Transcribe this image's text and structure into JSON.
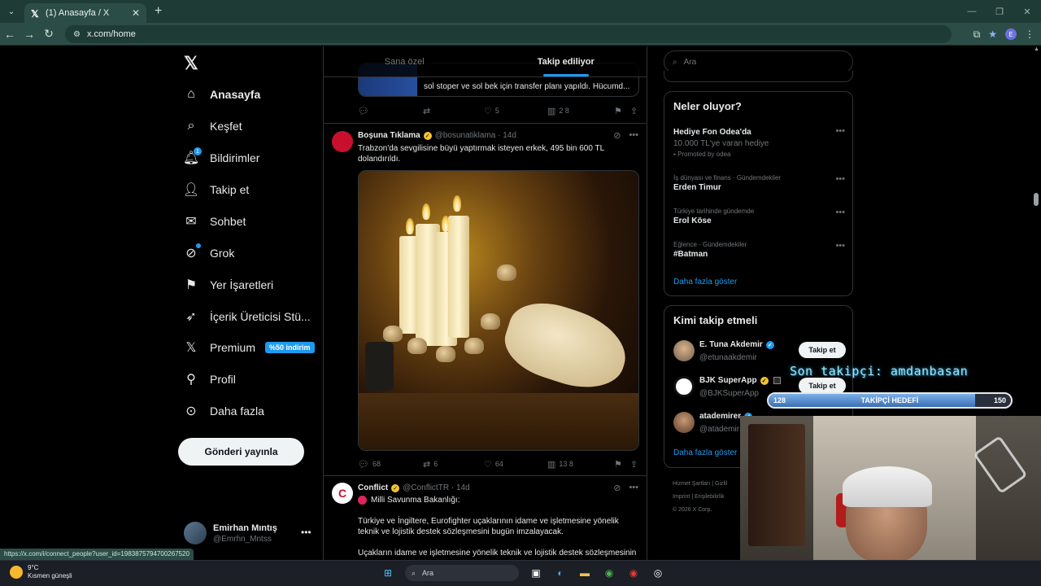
{
  "browser": {
    "tab_title": "(1) Anasayfa / X",
    "url": "x.com/home",
    "profile_initial": "E",
    "status_url": "https://x.com/i/connect_people?user_id=1983875794700267520"
  },
  "nav": {
    "items": [
      {
        "label": "Anasayfa",
        "icon": "home-icon"
      },
      {
        "label": "Keşfet",
        "icon": "search-icon"
      },
      {
        "label": "Bildirimler",
        "icon": "bell-icon",
        "badge": "1"
      },
      {
        "label": "Takip et",
        "icon": "add-user-icon"
      },
      {
        "label": "Sohbet",
        "icon": "mail-icon"
      },
      {
        "label": "Grok",
        "icon": "grok-icon"
      },
      {
        "label": "Yer İşaretleri",
        "icon": "bookmark-icon"
      },
      {
        "label": "İçerik Üreticisi Stü...",
        "icon": "rocket-icon"
      },
      {
        "label": "Premium",
        "icon": "x-icon",
        "promo": "%50 indirim"
      },
      {
        "label": "Profil",
        "icon": "person-icon"
      },
      {
        "label": "Daha fazla",
        "icon": "more-circle-icon"
      }
    ],
    "post_button": "Gönderi yayınla",
    "account": {
      "name": "Emirhan Mıntış",
      "handle": "@Emrhn_Mntss"
    }
  },
  "feed": {
    "tabs": [
      {
        "label": "Sana özel"
      },
      {
        "label": "Takip ediliyor"
      }
    ],
    "prev_card_text": "sol stoper ve sol bek için transfer planı yapıldı. Hücumd...",
    "prev_actions": {
      "reply": "",
      "repost": "",
      "like": "5",
      "views": "2 8"
    },
    "tweet1": {
      "name": "Boşuna Tıklama",
      "handle": "@bosunatiklama",
      "time": "14d",
      "text": "Trabzon'da sevgilisine büyü yaptırmak isteyen erkek, 495 bin 600 TL dolandırıldı.",
      "actions": {
        "reply": "68",
        "repost": "6",
        "like": "64",
        "views": "13 8"
      }
    },
    "tweet2": {
      "name": "Conflict",
      "handle": "@ConflictTR",
      "time": "14d",
      "line1": "Milli Savunma Bakanlığı:",
      "line2": "Türkiye ve İngiltere, Eurofighter uçaklarının idame ve işletmesine yönelik teknik ve lojistik destek sözleşmesini bugün imzalayacak.",
      "line3": "Uçakların idame ve işletmesine yönelik teknik ve lojistik destek sözleşmesinin"
    }
  },
  "right": {
    "search_placeholder": "Ara",
    "trends_title": "Neler oluyor?",
    "trends": [
      {
        "category": "",
        "name": "Hediye Fon Odea'da",
        "sub": "10.000 TL'ye varan hediye",
        "promo": "Promoted by odea"
      },
      {
        "category": "İş dünyası ve finans · Gündemdekiler",
        "name": "Erden Timur"
      },
      {
        "category": "Türkiye tarihinde gündemde",
        "name": "Erol Köse"
      },
      {
        "category": "Eğlence · Gündemdekiler",
        "name": "#Batman"
      }
    ],
    "show_more": "Daha fazla göster",
    "who_title": "Kimi takip etmeli",
    "who": [
      {
        "name": "E. Tuna Akdemir",
        "handle": "@etunaakdemir",
        "button": "Takip et"
      },
      {
        "name": "BJK SuperApp",
        "handle": "@BJKSuperApp",
        "button": "Takip et"
      },
      {
        "name": "atademirer",
        "handle": "@atademir"
      }
    ],
    "who_show_more": "Daha fazla göster",
    "footer": {
      "line1": "Hizmet Şartları  |  Gizlil",
      "line2": "Imprint  |  Erişilebilirlik",
      "line3": "© 2026 X Corp."
    }
  },
  "overlay": {
    "last_follower": "Son takipçi: amdanbasan",
    "goal_label": "TAKİPÇİ HEDEFİ",
    "goal_current": "128",
    "goal_target": "150",
    "goal_progress": 0.853,
    "kick_count": "5"
  },
  "taskbar": {
    "temp": "9°C",
    "weather": "Kısmen güneşli",
    "search": "Ara"
  },
  "colors": {
    "accent": "#1d9bf0",
    "chrome": "#2c4d47",
    "kick": "#53fc18"
  }
}
